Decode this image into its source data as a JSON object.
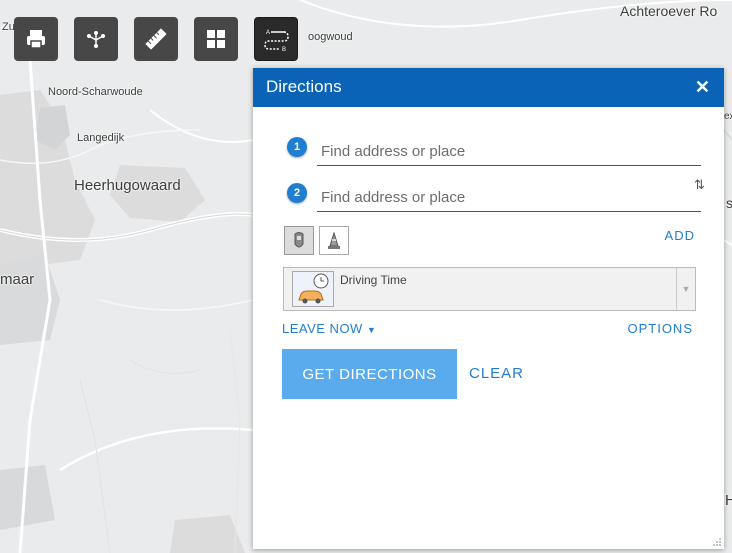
{
  "map": {
    "labels": {
      "zuid": "Zu",
      "achteroever": "Achteroever Ro",
      "hoogwoud": "oogwoud",
      "noord_scharwoude": "Noord-Scharwoude",
      "langedijk": "Langedijk",
      "heerhugowaard": "Heerhugowaard",
      "alkmaar": "maar",
      "ex": "ex",
      "s": "s",
      "h": "H"
    }
  },
  "toolbar": {
    "tools": [
      {
        "name": "print",
        "icon": "printer-icon"
      },
      {
        "name": "measure-share",
        "icon": "network-icon"
      },
      {
        "name": "measure",
        "icon": "ruler-icon"
      },
      {
        "name": "basemap-gallery",
        "icon": "grid-icon"
      },
      {
        "name": "directions",
        "icon": "directions-icon",
        "active": true
      }
    ]
  },
  "panel": {
    "title": "Directions",
    "close_symbol": "✕",
    "stops": [
      {
        "number": "1",
        "placeholder": "Find address or place",
        "value": ""
      },
      {
        "number": "2",
        "placeholder": "Find address or place",
        "value": ""
      }
    ],
    "swap_symbol": "⇅",
    "mode_buttons": [
      {
        "icon": "map-pin-icon",
        "selected": true
      },
      {
        "icon": "traffic-cone-icon",
        "selected": false
      }
    ],
    "add_label": "ADD",
    "travel_mode": {
      "selected": "Driving Time",
      "icon": "car-clock-icon"
    },
    "leave_now_label": "LEAVE NOW",
    "leave_now_caret": "▼",
    "options_label": "OPTIONS",
    "get_directions_label": "GET DIRECTIONS",
    "clear_label": "CLEAR"
  },
  "colors": {
    "header": "#0a63b7",
    "link": "#1f7ecf",
    "primary_button": "#5aaaee",
    "toolbar": "#474747",
    "map_background": "#eaebec"
  }
}
